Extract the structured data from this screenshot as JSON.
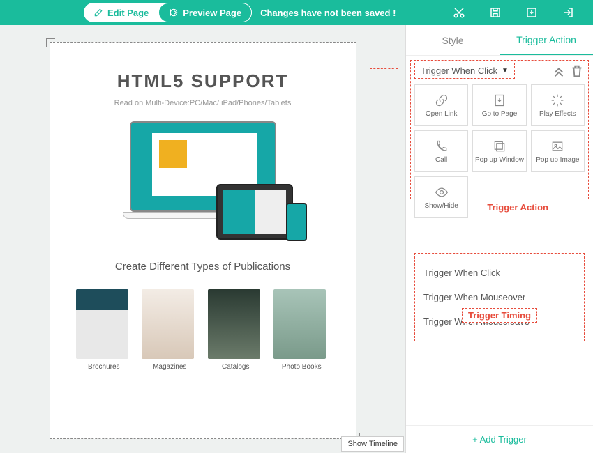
{
  "topbar": {
    "edit_label": "Edit Page",
    "preview_label": "Preview Page",
    "status": "Changes have not been saved !"
  },
  "canvas": {
    "title": "HTML5 SUPPORT",
    "subtitle": "Read on Multi-Device:PC/Mac/ iPad/Phones/Tablets",
    "pub_heading": "Create Different Types of Publications",
    "thumbs": [
      "Brochures",
      "Magazines",
      "Catalogs",
      "Photo Books"
    ],
    "show_timeline": "Show Timeline"
  },
  "sidebar": {
    "tabs": {
      "style": "Style",
      "trigger": "Trigger Action"
    },
    "trigger_dd": "Trigger When Click",
    "actions": [
      "Open Link",
      "Go to Page",
      "Play Effects",
      "Call",
      "Pop up Window",
      "Pop up Image",
      "Show/Hide"
    ],
    "timing": [
      "Trigger When Click",
      "Trigger When Mouseover",
      "Trigger When Mouseleave"
    ],
    "annot_action": "Trigger Action",
    "annot_timing": "Trigger Timing",
    "add_trigger": "+ Add Trigger"
  }
}
